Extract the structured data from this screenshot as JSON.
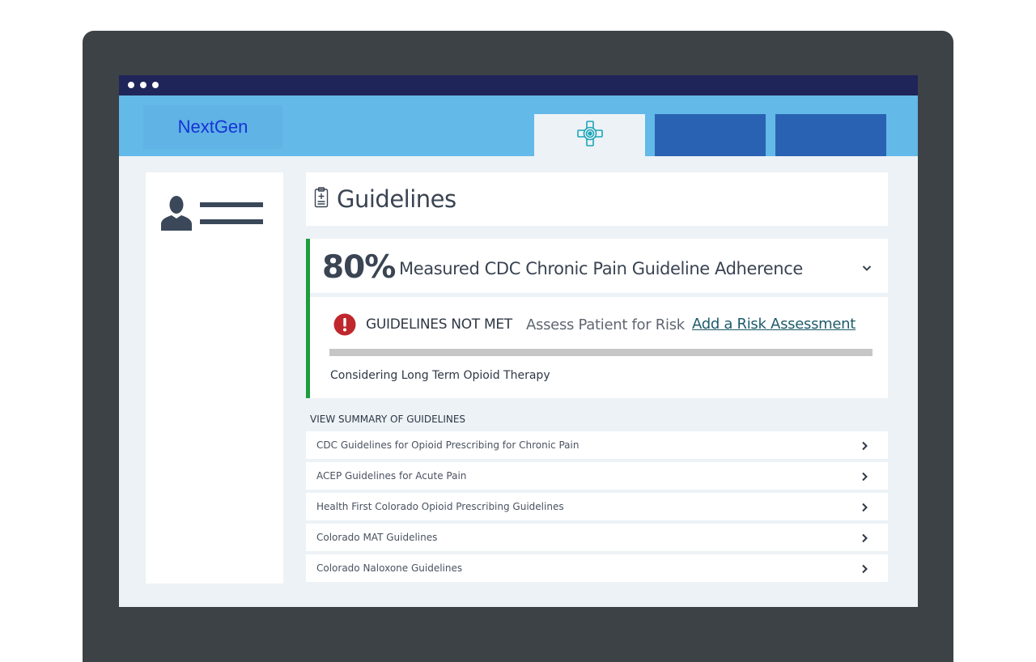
{
  "app": {
    "brand": "NextGen",
    "accent_color": "#63b9e8",
    "titlebar_color": "#1f2558",
    "tab_color": "#2a62b3"
  },
  "nav": {
    "tabs": [
      {
        "icon": "medical-cross-icon",
        "active": true
      },
      {
        "active": false
      },
      {
        "active": false
      }
    ]
  },
  "sidebar": {
    "icons": [
      "user-avatar-icon",
      "menu-lines-icon"
    ]
  },
  "page": {
    "icon": "clipboard-icon",
    "title": "Guidelines"
  },
  "adherence": {
    "percent": "80%",
    "label": "Measured CDC Chronic Pain Guideline Adherence",
    "border_color": "#1f9c3e"
  },
  "alert": {
    "icon": "alert-circle-icon",
    "status": "GUIDELINES NOT MET",
    "action_text": "Assess Patient for Risk",
    "link_text": "Add a Risk Assessment",
    "note": "Considering Long Term Opioid Therapy"
  },
  "summary": {
    "title": "VIEW SUMMARY OF GUIDELINES",
    "items": [
      {
        "label": "CDC Guidelines for Opioid Prescribing for Chronic Pain"
      },
      {
        "label": "ACEP Guidelines for Acute Pain"
      },
      {
        "label": "Health First Colorado Opioid Prescribing Guidelines"
      },
      {
        "label": "Colorado MAT Guidelines"
      },
      {
        "label": "Colorado Naloxone Guidelines"
      }
    ]
  }
}
